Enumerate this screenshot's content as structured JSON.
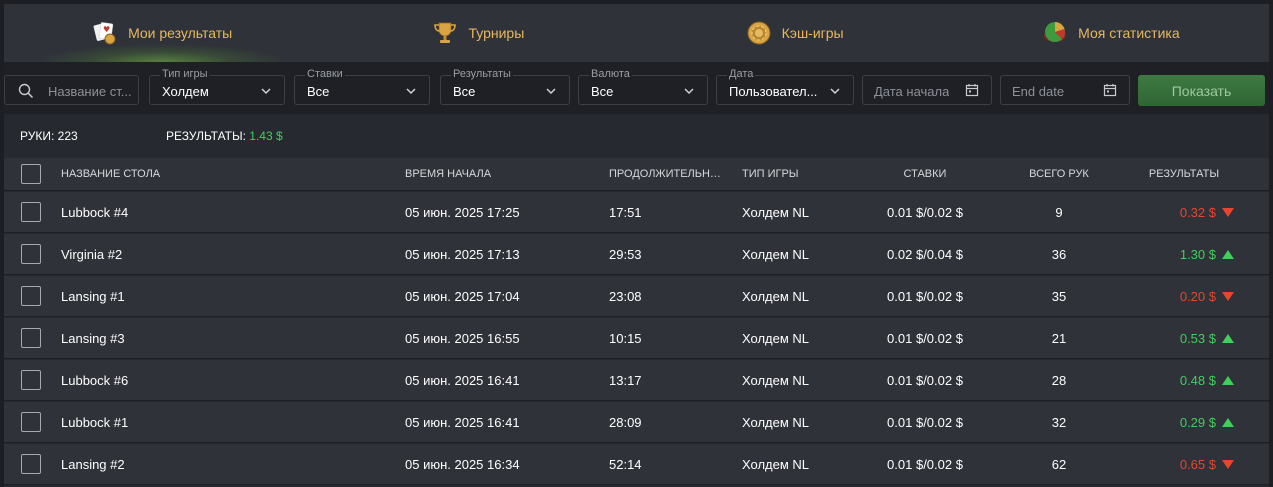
{
  "colors": {
    "accent_gold": "#e7b860",
    "positive": "#3fd05a",
    "negative": "#e8452f",
    "button": "#3f7a42"
  },
  "tabs": [
    {
      "label": "Мои результаты",
      "icon": "cards-chip-icon",
      "active": true
    },
    {
      "label": "Турниры",
      "icon": "trophy-icon",
      "active": false
    },
    {
      "label": "Кэш-игры",
      "icon": "chip-icon",
      "active": false
    },
    {
      "label": "Моя статистика",
      "icon": "pie-chart-icon",
      "active": false
    }
  ],
  "filters": {
    "search_placeholder": "Название ст...",
    "game_type": {
      "caption": "Тип игры",
      "value": "Холдем"
    },
    "stakes": {
      "caption": "Ставки",
      "value": "Все"
    },
    "results": {
      "caption": "Результаты",
      "value": "Все"
    },
    "currency": {
      "caption": "Валюта",
      "value": "Все"
    },
    "date": {
      "caption": "Дата",
      "value": "Пользовател..."
    },
    "start_date_placeholder": "Дата начала",
    "end_date_placeholder": "End date",
    "show_button": "Показать"
  },
  "summary": {
    "hands_label": "РУКИ:",
    "hands_value": "223",
    "results_label": "РЕЗУЛЬТАТЫ:",
    "results_value": "1.43 $"
  },
  "table": {
    "headers": {
      "name": "НАЗВАНИЕ СТОЛА",
      "start": "ВРЕМЯ НАЧАЛА",
      "duration": "ПРОДОЛЖИТЕЛЬНОСТЬ",
      "type": "ТИП ИГРЫ",
      "stakes": "СТАВКИ",
      "hands": "ВСЕГО РУК",
      "results": "РЕЗУЛЬТАТЫ"
    },
    "rows": [
      {
        "name": "Lubbock #4",
        "start": "05 июн. 2025 17:25",
        "duration": "17:51",
        "type": "Холдем NL",
        "stakes": "0.01 $/0.02 $",
        "hands": "9",
        "result": "0.32 $",
        "trend": "down"
      },
      {
        "name": "Virginia #2",
        "start": "05 июн. 2025 17:13",
        "duration": "29:53",
        "type": "Холдем NL",
        "stakes": "0.02 $/0.04 $",
        "hands": "36",
        "result": "1.30 $",
        "trend": "up"
      },
      {
        "name": "Lansing #1",
        "start": "05 июн. 2025 17:04",
        "duration": "23:08",
        "type": "Холдем NL",
        "stakes": "0.01 $/0.02 $",
        "hands": "35",
        "result": "0.20 $",
        "trend": "down"
      },
      {
        "name": "Lansing #3",
        "start": "05 июн. 2025 16:55",
        "duration": "10:15",
        "type": "Холдем NL",
        "stakes": "0.01 $/0.02 $",
        "hands": "21",
        "result": "0.53 $",
        "trend": "up"
      },
      {
        "name": "Lubbock #6",
        "start": "05 июн. 2025 16:41",
        "duration": "13:17",
        "type": "Холдем NL",
        "stakes": "0.01 $/0.02 $",
        "hands": "28",
        "result": "0.48 $",
        "trend": "up"
      },
      {
        "name": "Lubbock #1",
        "start": "05 июн. 2025 16:41",
        "duration": "28:09",
        "type": "Холдем NL",
        "stakes": "0.01 $/0.02 $",
        "hands": "32",
        "result": "0.29 $",
        "trend": "up"
      },
      {
        "name": "Lansing #2",
        "start": "05 июн. 2025 16:34",
        "duration": "52:14",
        "type": "Холдем NL",
        "stakes": "0.01 $/0.02 $",
        "hands": "62",
        "result": "0.65 $",
        "trend": "down"
      }
    ]
  }
}
